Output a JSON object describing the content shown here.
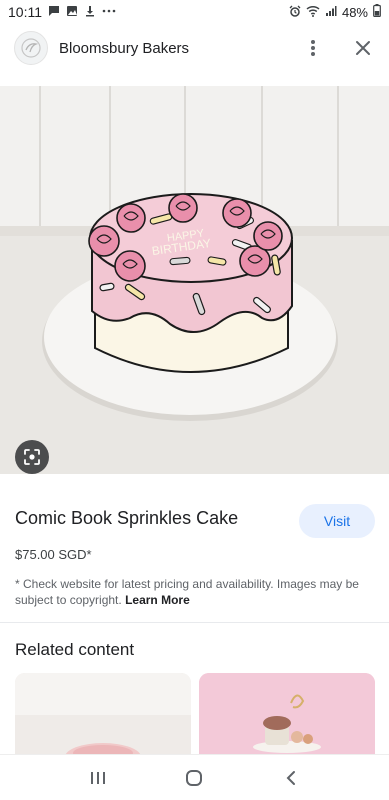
{
  "status_bar": {
    "time": "10:11",
    "battery": "48%",
    "left_icons": [
      "message-icon",
      "image-icon",
      "download-icon",
      "more-dots-icon"
    ],
    "right_icons": [
      "alarm-icon",
      "wifi-icon",
      "signal-icon",
      "battery-icon"
    ]
  },
  "header": {
    "site_name": "Bloomsbury Bakers",
    "actions": [
      "more-vert-icon",
      "close-icon"
    ]
  },
  "product": {
    "cake_text_line1": "HAPPY",
    "cake_text_line2": "BIRTHDAY",
    "title": "Comic Book Sprinkles Cake",
    "visit_label": "Visit",
    "price": "$75.00 SGD*",
    "disclaimer": "* Check website for latest pricing and availability. Images may be subject to copyright.",
    "learn_more": "Learn More"
  },
  "related": {
    "title": "Related content"
  },
  "colors": {
    "accent": "#1a73e8",
    "accent_bg": "#e8f0fe",
    "cake_pink": "#f2c6d2",
    "cake_cream": "#fbf6e6"
  }
}
